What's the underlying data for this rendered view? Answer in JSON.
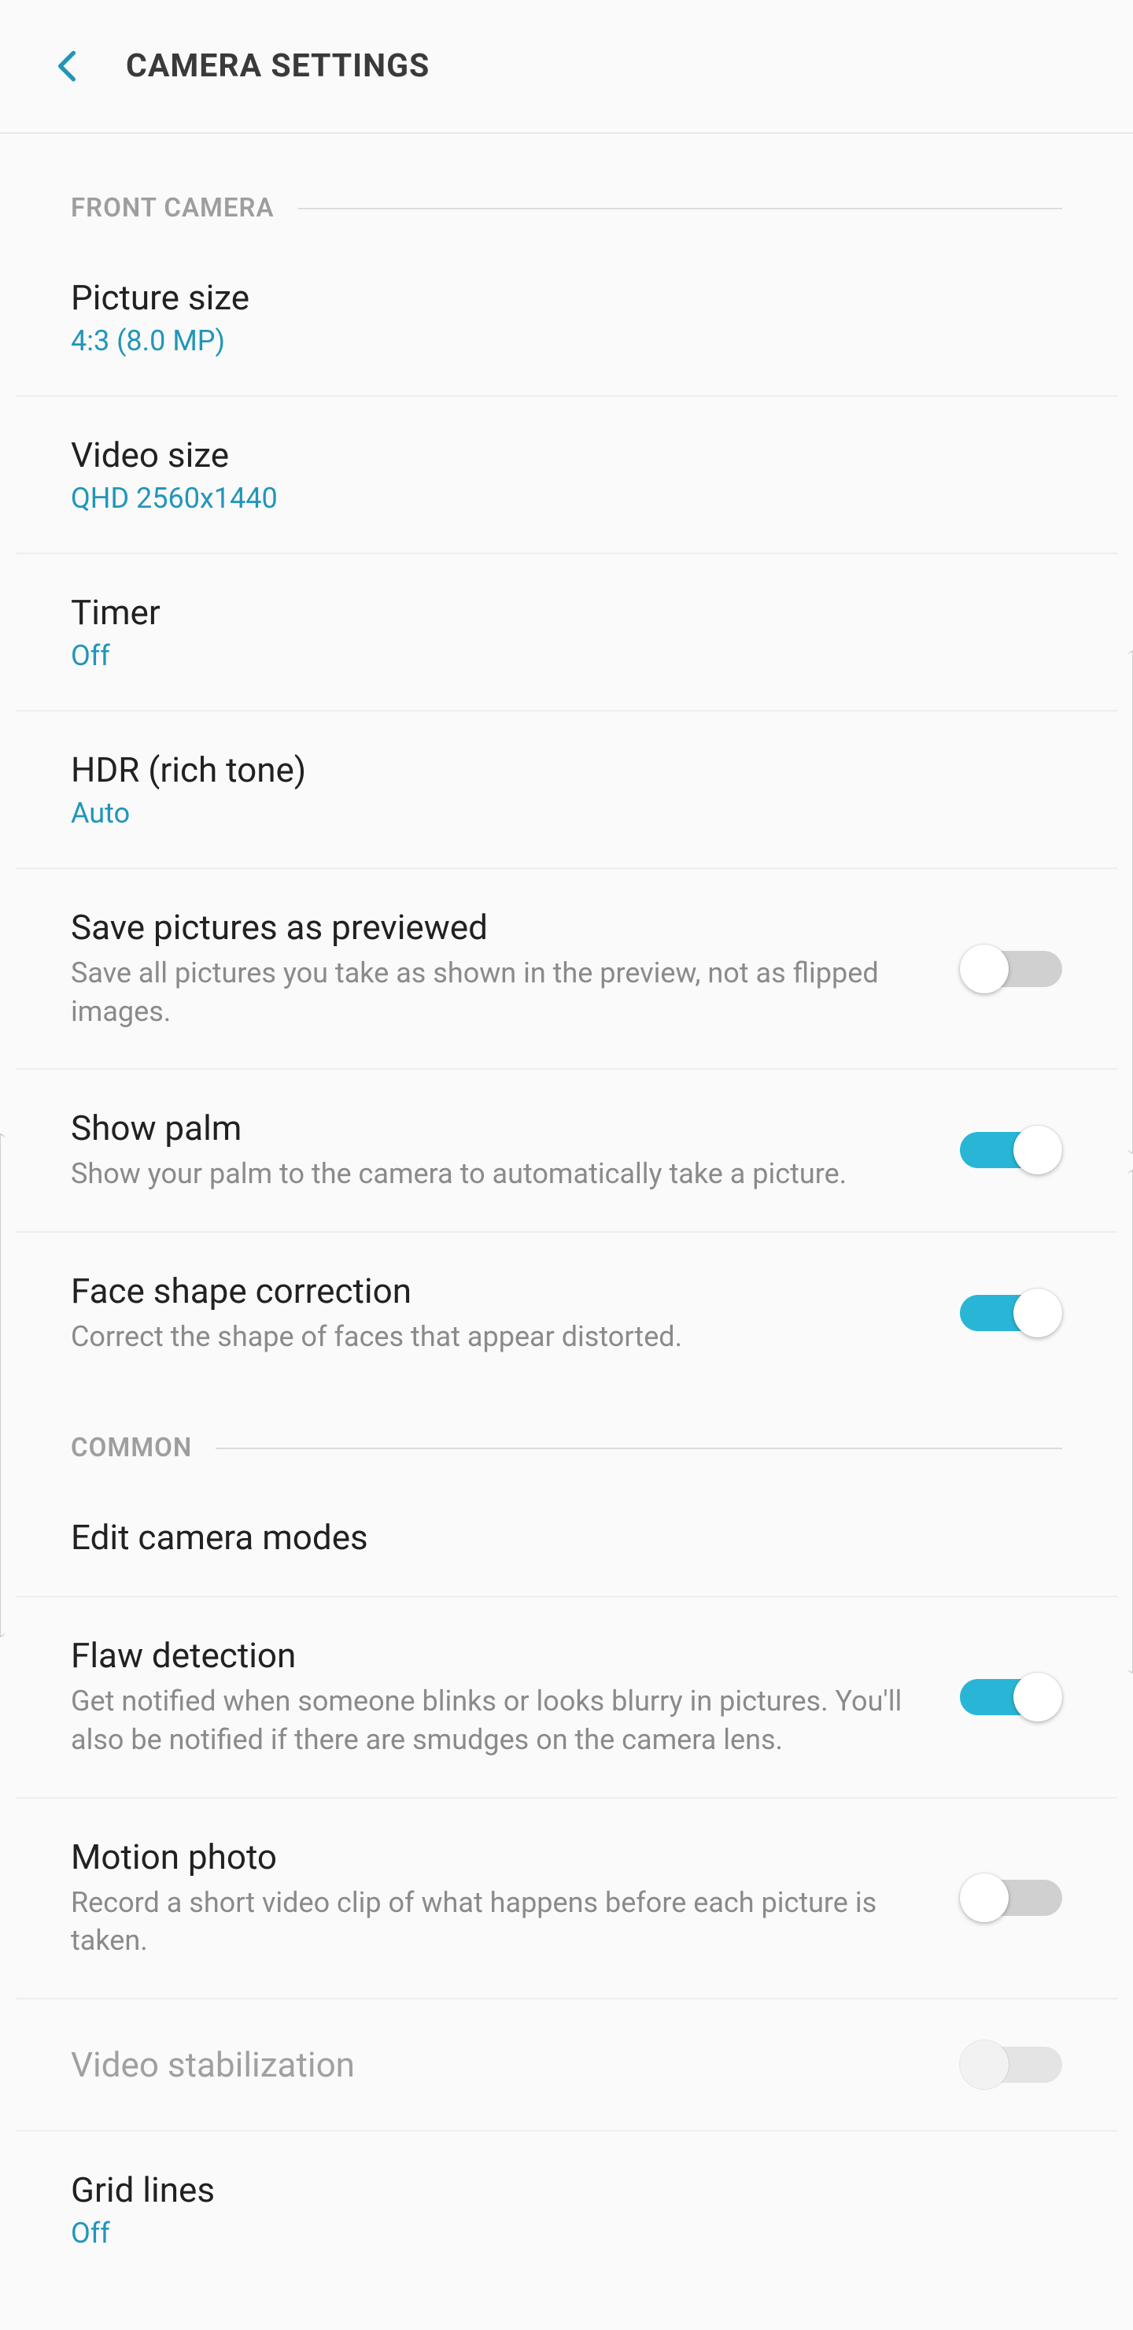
{
  "header": {
    "title": "CAMERA SETTINGS"
  },
  "sections": {
    "front_camera": {
      "label": "FRONT CAMERA",
      "items": {
        "picture_size": {
          "title": "Picture size",
          "value": "4:3 (8.0 MP)"
        },
        "video_size": {
          "title": "Video size",
          "value": "QHD 2560x1440"
        },
        "timer": {
          "title": "Timer",
          "value": "Off"
        },
        "hdr": {
          "title": "HDR (rich tone)",
          "value": "Auto"
        },
        "save_previewed": {
          "title": "Save pictures as previewed",
          "desc": "Save all pictures you take as shown in the preview, not as flipped images.",
          "on": false
        },
        "show_palm": {
          "title": "Show palm",
          "desc": "Show your palm to the camera to automatically take a picture.",
          "on": true
        },
        "face_shape": {
          "title": "Face shape correction",
          "desc": "Correct the shape of faces that appear distorted.",
          "on": true
        }
      }
    },
    "common": {
      "label": "COMMON",
      "items": {
        "edit_modes": {
          "title": "Edit camera modes"
        },
        "flaw_detection": {
          "title": "Flaw detection",
          "desc": "Get notified when someone blinks or looks blurry in pictures. You'll also be notified if there are smudges on the camera lens.",
          "on": true
        },
        "motion_photo": {
          "title": "Motion photo",
          "desc": "Record a short video clip of what happens before each picture is taken.",
          "on": false
        },
        "video_stabilization": {
          "title": "Video stabilization",
          "disabled": true,
          "on": false
        },
        "grid_lines": {
          "title": "Grid lines",
          "value": "Off"
        }
      }
    }
  }
}
